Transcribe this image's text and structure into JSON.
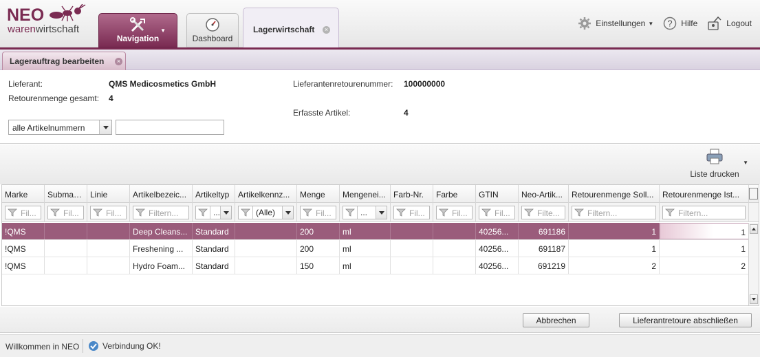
{
  "app": {
    "logo_top": "NEO",
    "logo_bottom_a": "waren",
    "logo_bottom_b": "wirtschaft"
  },
  "main_tabs": [
    {
      "label": "Navigation",
      "icon": "tools-icon"
    },
    {
      "label": "Dashboard",
      "icon": "speedometer-icon"
    },
    {
      "label": "Lagerwirtschaft",
      "icon": "close-icon"
    }
  ],
  "top_links": {
    "settings": "Einstellungen",
    "help": "Hilfe",
    "logout": "Logout"
  },
  "sub_tab": {
    "label": "Lagerauftrag bearbeiten"
  },
  "info": {
    "supplier_label": "Lieferant:",
    "supplier_value": "QMS Medicosmetics GmbH",
    "return_qty_label": "Retourenmenge gesamt:",
    "return_qty_value": "4",
    "return_no_label": "Lieferantenretourenummer:",
    "return_no_value": "100000000",
    "captured_label": "Erfasste Artikel:",
    "captured_value": "4"
  },
  "filter_select": {
    "value": "alle Artikelnummern"
  },
  "toolbar": {
    "print_label": "Liste drucken"
  },
  "grid": {
    "columns": [
      "Marke",
      "Submarke",
      "Linie",
      "Artikelbezeic...",
      "Artikeltyp",
      "Artikelkennz...",
      "Menge",
      "Mengenei...",
      "Farb-Nr.",
      "Farbe",
      "GTIN",
      "Neo-Artik...",
      "Retourenmenge Soll...",
      "Retourenmenge Ist..."
    ],
    "filters": [
      {
        "type": "text",
        "placeholder": "Fil..."
      },
      {
        "type": "text",
        "placeholder": "Fil..."
      },
      {
        "type": "text",
        "placeholder": "Fil..."
      },
      {
        "type": "text",
        "placeholder": "Filtern..."
      },
      {
        "type": "select",
        "value": "..."
      },
      {
        "type": "select",
        "value": "(Alle)"
      },
      {
        "type": "text",
        "placeholder": "Fil..."
      },
      {
        "type": "select",
        "value": "..."
      },
      {
        "type": "text",
        "placeholder": "Fil..."
      },
      {
        "type": "text",
        "placeholder": "Fil..."
      },
      {
        "type": "text",
        "placeholder": "Fil..."
      },
      {
        "type": "text",
        "placeholder": "Filte..."
      },
      {
        "type": "text",
        "placeholder": "Filtern..."
      },
      {
        "type": "text",
        "placeholder": "Filtern..."
      }
    ],
    "rows": [
      [
        "!QMS",
        "",
        "",
        "Deep Cleans...",
        "Standard",
        "",
        "200",
        "ml",
        "",
        "",
        "40256...",
        "691186",
        "1",
        "1"
      ],
      [
        "!QMS",
        "",
        "",
        "Freshening ...",
        "Standard",
        "",
        "200",
        "ml",
        "",
        "",
        "40256...",
        "691187",
        "1",
        "1"
      ],
      [
        "!QMS",
        "",
        "",
        "Hydro Foam...",
        "Standard",
        "",
        "150",
        "ml",
        "",
        "",
        "40256...",
        "691219",
        "2",
        "2"
      ]
    ],
    "selected_row": 0
  },
  "buttons": {
    "cancel": "Abbrechen",
    "finish": "Lieferantretoure abschließen"
  },
  "status": {
    "welcome": "Willkommen in NEO",
    "connection": "Verbindung OK!"
  },
  "colors": {
    "brand": "#7a2b52",
    "selected_row": "#9a5c7b"
  }
}
